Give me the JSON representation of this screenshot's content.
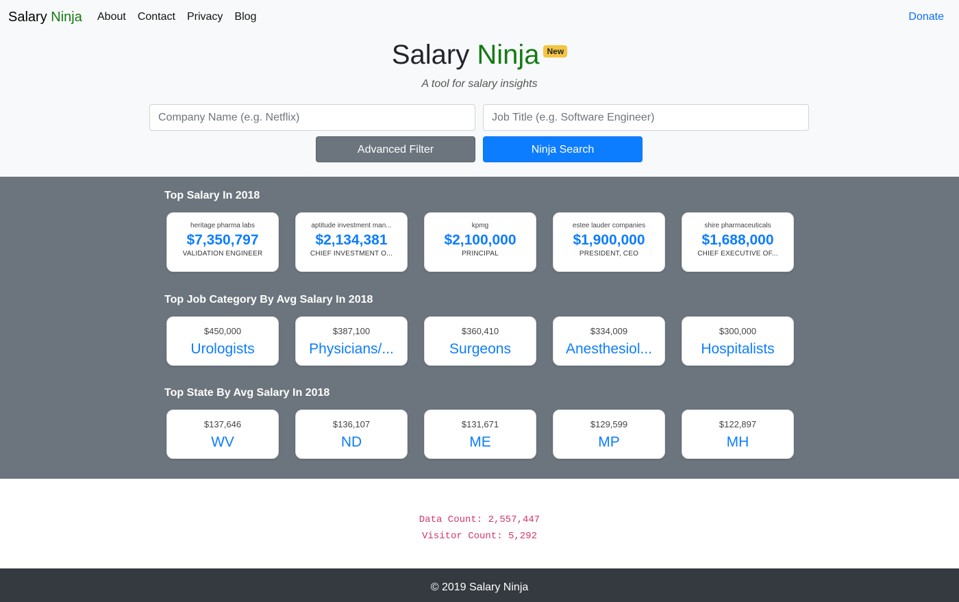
{
  "nav": {
    "brand_part1": "Salary",
    "brand_part2": "Ninja",
    "links": [
      "About",
      "Contact",
      "Privacy",
      "Blog"
    ],
    "donate": "Donate"
  },
  "hero": {
    "title_part1": "Salary",
    "title_part2": "Ninja",
    "badge": "New",
    "subtitle": "A tool for salary insights"
  },
  "search": {
    "company_placeholder": "Company Name (e.g. Netflix)",
    "job_placeholder": "Job Title (e.g. Software Engineer)",
    "advanced_label": "Advanced Filter",
    "search_label": "Ninja Search"
  },
  "sections": {
    "top_salary": {
      "title": "Top Salary In 2018",
      "cards": [
        {
          "company": "heritage pharma labs",
          "amount": "$7,350,797",
          "role": "VALIDATION ENGINEER"
        },
        {
          "company": "aptitude investment man...",
          "amount": "$2,134,381",
          "role": "CHIEF INVESTMENT O..."
        },
        {
          "company": "kpmg",
          "amount": "$2,100,000",
          "role": "PRINCIPAL"
        },
        {
          "company": "estee lauder companies",
          "amount": "$1,900,000",
          "role": "PRESIDENT, CEO"
        },
        {
          "company": "shire pharmaceuticals",
          "amount": "$1,688,000",
          "role": "CHIEF EXECUTIVE OF..."
        }
      ]
    },
    "top_category": {
      "title": "Top Job Category By Avg Salary In 2018",
      "cards": [
        {
          "amount": "$450,000",
          "label": "Urologists"
        },
        {
          "amount": "$387,100",
          "label": "Physicians/..."
        },
        {
          "amount": "$360,410",
          "label": "Surgeons"
        },
        {
          "amount": "$334,009",
          "label": "Anesthesiol..."
        },
        {
          "amount": "$300,000",
          "label": "Hospitalists"
        }
      ]
    },
    "top_state": {
      "title": "Top State By Avg Salary In 2018",
      "cards": [
        {
          "amount": "$137,646",
          "label": "WV"
        },
        {
          "amount": "$136,107",
          "label": "ND"
        },
        {
          "amount": "$131,671",
          "label": "ME"
        },
        {
          "amount": "$129,599",
          "label": "MP"
        },
        {
          "amount": "$122,897",
          "label": "MH"
        }
      ]
    }
  },
  "stats": {
    "data_count": "Data Count: 2,557,447",
    "visitor_count": "Visitor Count: 5,292"
  },
  "footer": {
    "copyright": "© 2019 Salary Ninja"
  },
  "colors": {
    "brand_green": "#137a13",
    "primary_blue": "#0d7dff",
    "band_gray": "#6c757d",
    "footer_dark": "#343a40",
    "stat_pink": "#d6336c"
  }
}
